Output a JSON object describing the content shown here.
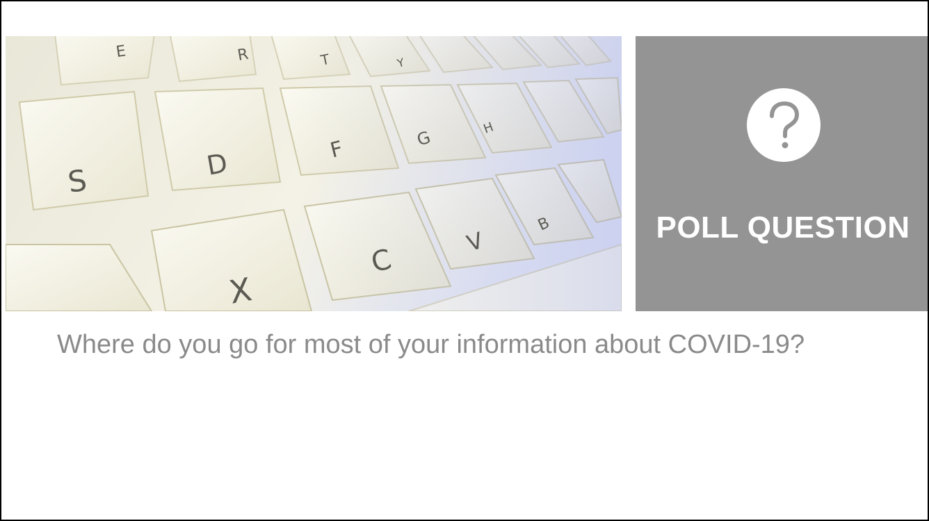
{
  "slide": {
    "banner": {
      "image": "keyboard-closeup",
      "key_letters": [
        "E",
        "R",
        "T",
        "Y",
        "S",
        "D",
        "F",
        "G",
        "H",
        "X",
        "C",
        "V",
        "B"
      ]
    },
    "poll": {
      "icon": "question-mark-icon",
      "label": "POLL QUESTION",
      "panel_color": "#949494"
    },
    "question": "Where do you go for most of your information about COVID-19?",
    "colors": {
      "question_text": "#8a8a8a",
      "label_text": "#ffffff",
      "border": "#000000"
    }
  }
}
